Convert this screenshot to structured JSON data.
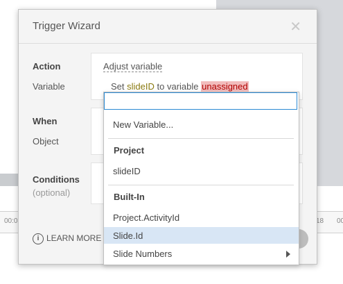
{
  "background": {
    "timeline": {
      "tick_left": "00:0",
      "tick_right_1": "18",
      "tick_right_2": "00"
    }
  },
  "dialog": {
    "title": "Trigger Wizard",
    "close_icon": "close-icon",
    "action": {
      "label": "Action",
      "value": "Adjust variable",
      "variable_label": "Variable",
      "sentence_prefix": "Set",
      "variable_name": "slideID",
      "sentence_middle": "to variable",
      "target_value": "unassigned"
    },
    "when": {
      "label": "When",
      "object_label": "Object"
    },
    "conditions": {
      "label": "Conditions",
      "sublabel": "(optional)"
    },
    "footer": {
      "learn_more": "LEARN MORE",
      "info_icon": "info-icon"
    }
  },
  "dropdown": {
    "search_value": "",
    "new_variable": "New Variable...",
    "sections": [
      {
        "header": "Project",
        "items": [
          "slideID"
        ]
      },
      {
        "header": "Built-In",
        "items": [
          "Project.ActivityId",
          "Slide.Id",
          "Slide Numbers"
        ]
      }
    ],
    "selected_item": "Slide.Id",
    "submenu_icon": "chevron-right-icon"
  },
  "colors": {
    "accent_blue": "#2a8ad4",
    "selected_bg": "#d8e6f5",
    "variable_color": "#8a7a10",
    "unassigned_bg": "#f2bcbc",
    "unassigned_text": "#b00000"
  }
}
